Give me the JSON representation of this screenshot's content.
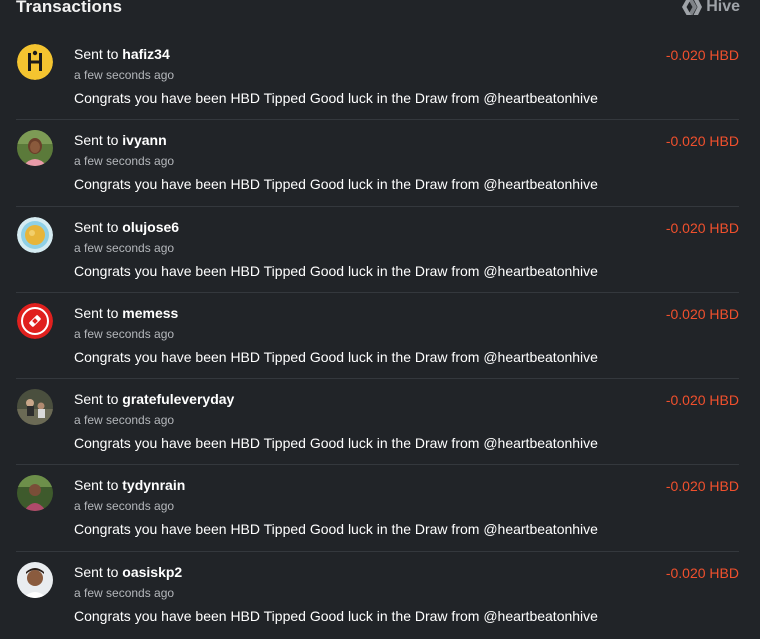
{
  "header": {
    "title": "Transactions",
    "brand": "Hive",
    "brand_icon": "hive-logo-icon"
  },
  "colors": {
    "background": "#212428",
    "amount_negative": "#f0502d",
    "divider": "#34383d",
    "muted_text": "#b4b7bb"
  },
  "transactions": [
    {
      "prefix": "Sent to",
      "user": "hafiz34",
      "time": "a few seconds ago",
      "memo": "Congrats you have been HBD Tipped Good luck in the Draw from @heartbeatonhive",
      "amount": "-0.020 HBD"
    },
    {
      "prefix": "Sent to",
      "user": "ivyann",
      "time": "a few seconds ago",
      "memo": "Congrats you have been HBD Tipped Good luck in the Draw from @heartbeatonhive",
      "amount": "-0.020 HBD"
    },
    {
      "prefix": "Sent to",
      "user": "olujose6",
      "time": "a few seconds ago",
      "memo": "Congrats you have been HBD Tipped Good luck in the Draw from @heartbeatonhive",
      "amount": "-0.020 HBD"
    },
    {
      "prefix": "Sent to",
      "user": "memess",
      "time": "a few seconds ago",
      "memo": "Congrats you have been HBD Tipped Good luck in the Draw from @heartbeatonhive",
      "amount": "-0.020 HBD"
    },
    {
      "prefix": "Sent to",
      "user": "gratefuleveryday",
      "time": "a few seconds ago",
      "memo": "Congrats you have been HBD Tipped Good luck in the Draw from @heartbeatonhive",
      "amount": "-0.020 HBD"
    },
    {
      "prefix": "Sent to",
      "user": "tydynrain",
      "time": "a few seconds ago",
      "memo": "Congrats you have been HBD Tipped Good luck in the Draw from @heartbeatonhive",
      "amount": "-0.020 HBD"
    },
    {
      "prefix": "Sent to",
      "user": "oasiskp2",
      "time": "a few seconds ago",
      "memo": "Congrats you have been HBD Tipped Good luck in the Draw from @heartbeatonhive",
      "amount": "-0.020 HBD"
    }
  ]
}
